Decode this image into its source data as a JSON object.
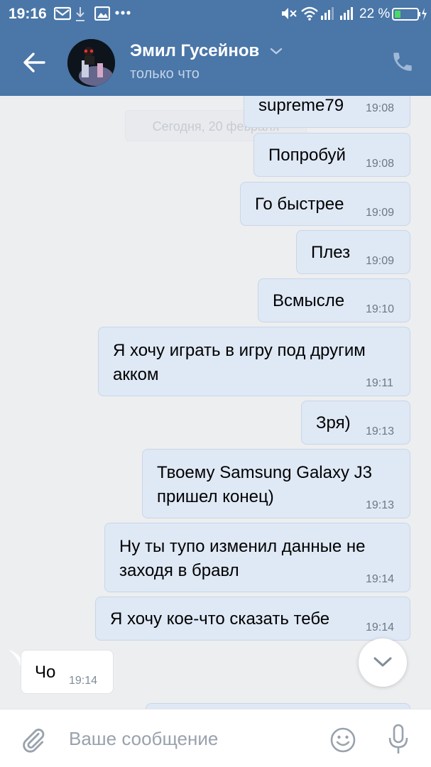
{
  "status_bar": {
    "time": "19:16",
    "battery_percent": "22 %",
    "icons": [
      "mail-icon",
      "download-icon",
      "image-icon",
      "more-icon",
      "mute-icon",
      "wifi-icon",
      "signal-icon",
      "signal-icon",
      "battery-charging-icon"
    ]
  },
  "header": {
    "contact_name": "Эмил Гусейнов",
    "status": "только что",
    "icons": [
      "back-arrow-icon",
      "chevron-down-icon",
      "phone-icon"
    ]
  },
  "chat": {
    "date_separator": "Сегодня, 20 февраля",
    "messages": [
      {
        "direction": "out",
        "lines": [
          "supreme79"
        ],
        "time": "19:08"
      },
      {
        "direction": "out",
        "lines": [
          "Попробуй"
        ],
        "time": "19:08"
      },
      {
        "direction": "out",
        "lines": [
          "Го быстрее"
        ],
        "time": "19:09"
      },
      {
        "direction": "out",
        "lines": [
          "Плез"
        ],
        "time": "19:09"
      },
      {
        "direction": "out",
        "lines": [
          "Всмысле"
        ],
        "time": "19:10"
      },
      {
        "direction": "out",
        "lines": [
          "Я хочу играть в игру под другим",
          "акком"
        ],
        "time": "19:11"
      },
      {
        "direction": "out",
        "lines": [
          "Зря)"
        ],
        "time": "19:13"
      },
      {
        "direction": "out",
        "lines": [
          "Твоему Samsung Galaxy J3",
          "пришел конец)"
        ],
        "time": "19:13"
      },
      {
        "direction": "out",
        "lines": [
          "Ну ты тупо изменил данные не",
          "заходя в бравл"
        ],
        "time": "19:14"
      },
      {
        "direction": "out",
        "lines": [
          "Я хочу кое-что сказать тебе"
        ],
        "time": "19:14"
      },
      {
        "direction": "in",
        "lines": [
          "Чо"
        ],
        "time": "19:14"
      }
    ]
  },
  "composer": {
    "placeholder": "Ваше сообщение",
    "value": "",
    "icons": [
      "paperclip-icon",
      "emoji-icon",
      "microphone-icon"
    ]
  },
  "colors": {
    "header_bg": "#4a76a8",
    "outgoing_bubble": "#dfe8f5",
    "incoming_bubble": "#ffffff",
    "chat_bg": "#edeef0"
  }
}
